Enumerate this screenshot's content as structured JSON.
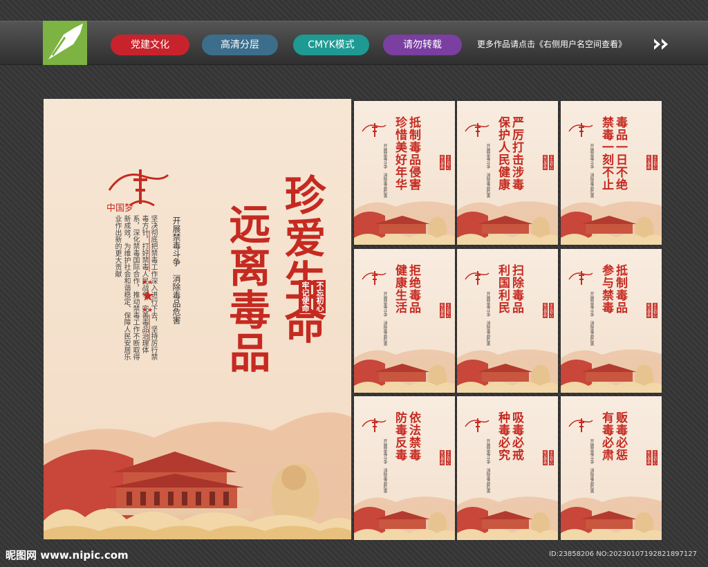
{
  "header": {
    "badges": [
      "党建文化",
      "高清分层",
      "CMYK模式",
      "请勿转载"
    ],
    "more_text": "更多作品请点击《右侧用户名空间查看》"
  },
  "main_poster": {
    "slogan_1": "珍爱生命",
    "slogan_2": "远离毒品",
    "tags": [
      "不忘初心",
      "牢记使命"
    ],
    "subtitle": "开展禁毒斗争　消除毒品危害",
    "body": "坚决彻底把禁毒工作深入进行下去，坚持厉行禁毒方针，打好禁毒人民战争，完善毒品治理体系，深化禁毒国际合作，推动禁毒工作不断取得新成效，为维护社会和谐稳定、保障人民安居乐业作出新的更大贡献",
    "logo_text": "中国梦"
  },
  "small_posters": [
    {
      "title": "抵制毒品侵害\n珍惜美好年华"
    },
    {
      "title": "严厉打击涉毒\n保护人民健康"
    },
    {
      "title": "毒品一日不绝\n禁毒一刻不止"
    },
    {
      "title": "拒绝毒品\n健康生活"
    },
    {
      "title": "扫除毒品\n利国利民"
    },
    {
      "title": "抵制毒品\n参与禁毒"
    },
    {
      "title": "依法禁毒\n防毒反毒"
    },
    {
      "title": "吸毒必戒\n种毒必究"
    },
    {
      "title": "贩毒必惩\n有毒必肃"
    }
  ],
  "small_poster_common": {
    "sub": "开展禁毒斗争　消除毒品危害",
    "tags": [
      "不忘初心",
      "牢记使命"
    ]
  },
  "footer": {
    "site": "昵图网 www.nipic.com",
    "id": "ID:23858206 NO:20230107192821897127"
  },
  "colors": {
    "accent_red": "#c52a21",
    "poster_bg": "#f6e6d4",
    "logo_green": "#7cb342"
  }
}
